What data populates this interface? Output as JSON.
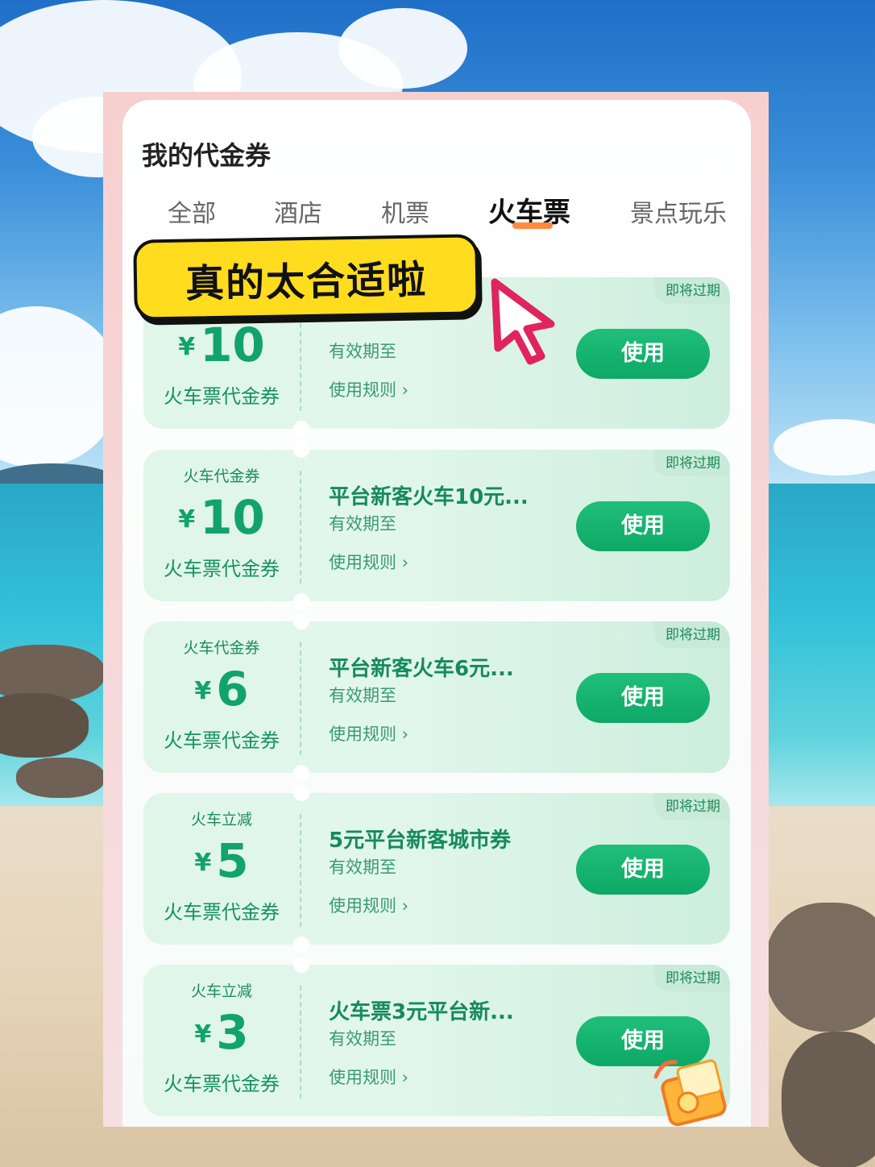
{
  "page": {
    "title": "我的代金券",
    "sticker": "真的太合适啦"
  },
  "tabs": [
    {
      "label": "全部",
      "active": false
    },
    {
      "label": "酒店",
      "active": false
    },
    {
      "label": "机票",
      "active": false
    },
    {
      "label": "火车票",
      "active": true
    },
    {
      "label": "景点玩乐",
      "active": false
    }
  ],
  "coupons": [
    {
      "kind": "",
      "currency": "¥",
      "amount": "10",
      "sub": "火车票代金券",
      "name": "",
      "valid": "有效期至",
      "rules": "使用规则 ›",
      "button": "使用",
      "expiry": "即将过期"
    },
    {
      "kind": "火车代金券",
      "currency": "¥",
      "amount": "10",
      "sub": "火车票代金券",
      "name": "平台新客火车10元...",
      "valid": "有效期至",
      "rules": "使用规则 ›",
      "button": "使用",
      "expiry": "即将过期"
    },
    {
      "kind": "火车代金券",
      "currency": "¥",
      "amount": "6",
      "sub": "火车票代金券",
      "name": "平台新客火车6元...",
      "valid": "有效期至",
      "rules": "使用规则 ›",
      "button": "使用",
      "expiry": "即将过期"
    },
    {
      "kind": "火车立减",
      "currency": "¥",
      "amount": "5",
      "sub": "火车票代金券",
      "name": "5元平台新客城市券",
      "valid": "有效期至",
      "rules": "使用规则 ›",
      "button": "使用",
      "expiry": "即将过期"
    },
    {
      "kind": "火车立减",
      "currency": "¥",
      "amount": "3",
      "sub": "火车票代金券",
      "name": "火车票3元平台新...",
      "valid": "有效期至",
      "rules": "使用规则 ›",
      "button": "使用",
      "expiry": "即将过期"
    }
  ],
  "colors": {
    "accent": "#12a36a",
    "tab_indicator": "#ff8a3d",
    "sticker_bg": "#ffdd1e",
    "cursor": "#e0245e"
  },
  "icons": {
    "cursor": "pointer-cursor-icon",
    "gift": "gift-coupon-icon"
  }
}
